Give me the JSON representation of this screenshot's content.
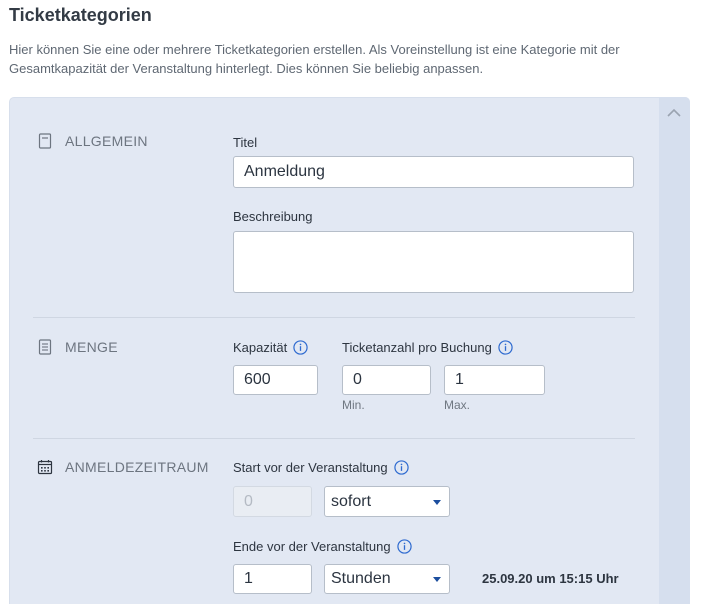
{
  "page": {
    "title": "Ticketkategorien",
    "intro": "Hier können Sie eine oder mehrere Ticketkategorien erstellen. Als Voreinstellung ist eine Kategorie mit der Gesamtkapazität der Veranstaltung hinterlegt. Dies können Sie beliebig anpassen."
  },
  "sections": {
    "allgemein": {
      "label": "ALLGEMEIN",
      "icon": "document-icon",
      "title_label": "Titel",
      "title_value": "Anmeldung",
      "description_label": "Beschreibung",
      "description_value": ""
    },
    "menge": {
      "label": "MENGE",
      "icon": "list-icon",
      "capacity_label": "Kapazität",
      "capacity_value": "600",
      "tickets_label": "Ticketanzahl pro Buchung",
      "min_value": "0",
      "max_value": "1",
      "min_hint": "Min.",
      "max_hint": "Max."
    },
    "anmeldezeitraum": {
      "label": "ANMELDEZEITRAUM",
      "icon": "calendar-icon",
      "start_label": "Start vor der Veranstaltung",
      "start_amount": "0",
      "start_unit": "sofort",
      "end_label": "Ende vor der Veranstaltung",
      "end_amount": "1",
      "end_unit": "Stunden",
      "end_datetime": "25.09.20 um 15:15 Uhr"
    }
  },
  "colors": {
    "panel_bg": "#e2e8f3",
    "accent": "#1c4e9e",
    "info_icon": "#2f6bd0"
  }
}
